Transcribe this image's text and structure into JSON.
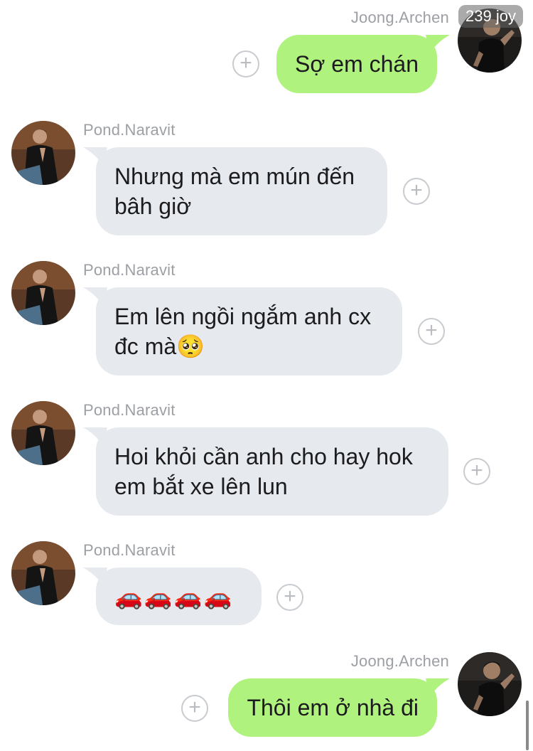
{
  "counter": {
    "label": "239 joy",
    "icon": "lock-icon"
  },
  "colors": {
    "incoming_bubble": "#e6e9ed",
    "outgoing_bubble": "#b0f27e",
    "sender_name": "#9c9fa4"
  },
  "messages": [
    {
      "sender": "Joong.Archen",
      "direction": "outgoing",
      "lines": [
        "Sợ em chán"
      ]
    },
    {
      "sender": "Pond.Naravit",
      "direction": "incoming",
      "lines": [
        "Nhưng mà em mún đến",
        "bâh giờ"
      ]
    },
    {
      "sender": "Pond.Naravit",
      "direction": "incoming",
      "lines": [
        "Em lên ngồi ngắm anh cx",
        "đc mà🥺"
      ]
    },
    {
      "sender": "Pond.Naravit",
      "direction": "incoming",
      "lines": [
        "Hoi khỏi cần anh cho hay hok",
        "em bắt xe lên lun"
      ]
    },
    {
      "sender": "Pond.Naravit",
      "direction": "incoming",
      "lines": [
        "🚗🚗🚗🚗"
      ]
    },
    {
      "sender": "Joong.Archen",
      "direction": "outgoing",
      "lines": [
        "Thôi em ở nhà đi"
      ]
    }
  ],
  "reaction_icon": "plus-circle-icon"
}
